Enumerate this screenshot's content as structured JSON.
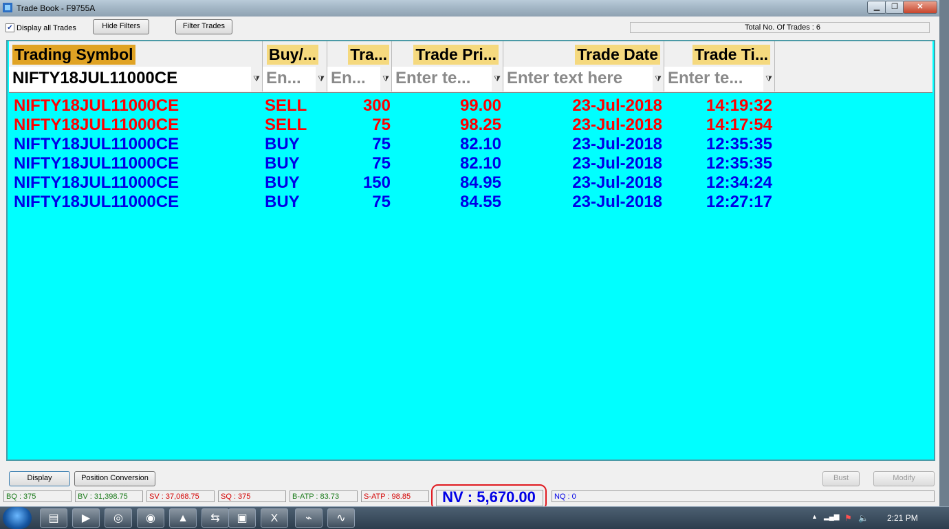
{
  "window": {
    "title": "Trade Book - F9755A",
    "min_glyph": "▁",
    "max_glyph": "❐",
    "close_glyph": "✕"
  },
  "toolbar": {
    "display_all_label": "Display all Trades",
    "display_all_checked": "✔",
    "hide_filters_label": "Hide Filters",
    "filter_trades_label": "Filter Trades",
    "total_trades": "Total No. Of Trades : 6"
  },
  "columns": [
    {
      "label": "Trading Symbol"
    },
    {
      "label": "Buy/..."
    },
    {
      "label": "Tra..."
    },
    {
      "label": "Trade Pri..."
    },
    {
      "label": "Trade Date"
    },
    {
      "label": "Trade Ti..."
    }
  ],
  "filters": [
    {
      "value": "NIFTY18JUL11000CE",
      "placeholder": ""
    },
    {
      "value": "",
      "placeholder": "En..."
    },
    {
      "value": "",
      "placeholder": "En..."
    },
    {
      "value": "",
      "placeholder": "Enter te..."
    },
    {
      "value": "",
      "placeholder": "Enter text here"
    },
    {
      "value": "",
      "placeholder": "Enter te..."
    }
  ],
  "filter_icon": "⧩",
  "trades": [
    {
      "symbol": "NIFTY18JUL11000CE",
      "side": "SELL",
      "qty": "300",
      "price": "99.00",
      "date": "23-Jul-2018",
      "time": "14:19:32"
    },
    {
      "symbol": "NIFTY18JUL11000CE",
      "side": "SELL",
      "qty": "75",
      "price": "98.25",
      "date": "23-Jul-2018",
      "time": "14:17:54"
    },
    {
      "symbol": "NIFTY18JUL11000CE",
      "side": "BUY",
      "qty": "75",
      "price": "82.10",
      "date": "23-Jul-2018",
      "time": "12:35:35"
    },
    {
      "symbol": "NIFTY18JUL11000CE",
      "side": "BUY",
      "qty": "75",
      "price": "82.10",
      "date": "23-Jul-2018",
      "time": "12:35:35"
    },
    {
      "symbol": "NIFTY18JUL11000CE",
      "side": "BUY",
      "qty": "150",
      "price": "84.95",
      "date": "23-Jul-2018",
      "time": "12:34:24"
    },
    {
      "symbol": "NIFTY18JUL11000CE",
      "side": "BUY",
      "qty": "75",
      "price": "84.55",
      "date": "23-Jul-2018",
      "time": "12:27:17"
    }
  ],
  "bottom": {
    "display_label": "Display",
    "position_conversion_label": "Position Conversion",
    "bust_label": "Bust",
    "modify_label": "Modify"
  },
  "status": {
    "bq": "BQ : 375",
    "bv": "BV : 31,398.75",
    "sv": "SV : 37,068.75",
    "sq": "SQ : 375",
    "batp": "B-ATP : 83.73",
    "satp": "S-ATP : 98.85",
    "nv": "NV : 5,670.00",
    "nq": "NQ : 0"
  },
  "taskbar": {
    "apps": [
      {
        "icon": "folder-icon",
        "glyph": "▤"
      },
      {
        "icon": "media-player-icon",
        "glyph": "▶"
      },
      {
        "icon": "lifebuoy-icon",
        "glyph": "◎"
      },
      {
        "icon": "chrome-icon",
        "glyph": "◉"
      },
      {
        "icon": "triangle-app-icon",
        "glyph": "▲"
      },
      {
        "icon": "network-app-icon",
        "glyph": "⇆"
      },
      {
        "icon": "window-app-icon",
        "glyph": "▣"
      },
      {
        "icon": "excel-icon",
        "glyph": "X"
      },
      {
        "icon": "acrobat-icon",
        "glyph": "⌁"
      },
      {
        "icon": "chart-app-icon",
        "glyph": "∿"
      }
    ],
    "tray_expand_glyph": "▲",
    "signal_glyph": "▂▄▆",
    "flag_glyph": "⚑",
    "volume_glyph": "🔈",
    "clock": "2:21 PM"
  },
  "colors": {
    "sell": "#ff0000",
    "buy": "#0000e6",
    "grid_bg": "#00ffff",
    "header_first": "#e0a324",
    "header": "#f5d97e"
  }
}
